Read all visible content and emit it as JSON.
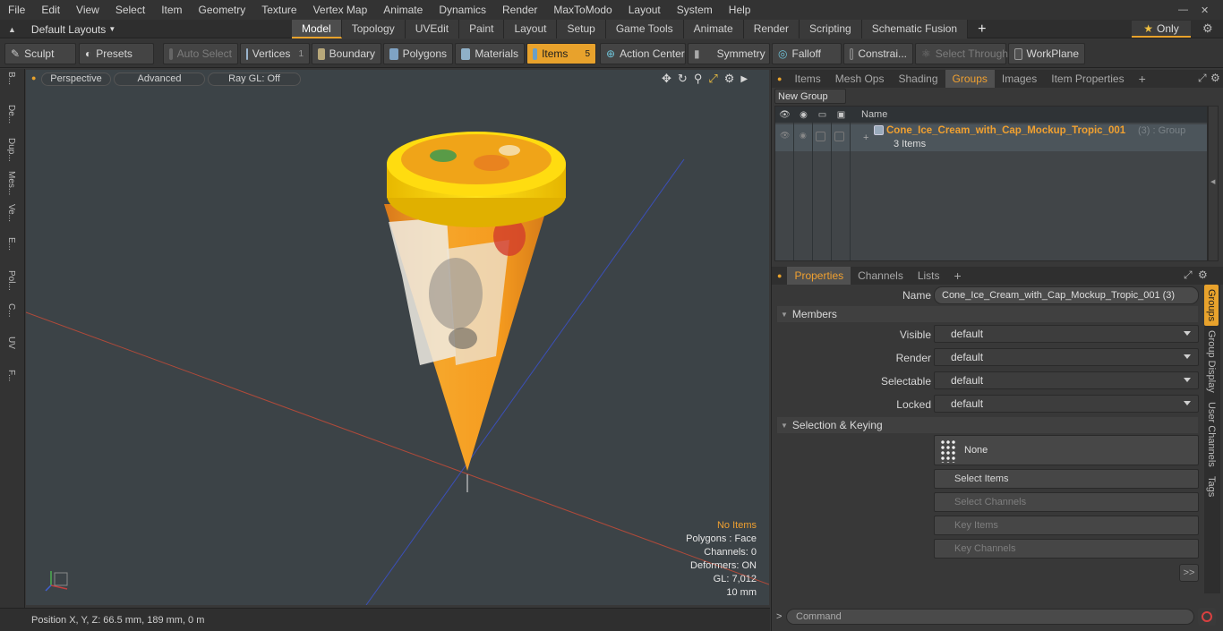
{
  "menubar": {
    "items": [
      "File",
      "Edit",
      "View",
      "Select",
      "Item",
      "Geometry",
      "Texture",
      "Vertex Map",
      "Animate",
      "Dynamics",
      "Render",
      "MaxToModo",
      "Layout",
      "System",
      "Help"
    ]
  },
  "layoutbar": {
    "layout_name": "Default Layouts",
    "tabs": [
      "Model",
      "Topology",
      "UVEdit",
      "Paint",
      "Layout",
      "Setup",
      "Game Tools",
      "Animate",
      "Render",
      "Scripting",
      "Schematic Fusion"
    ],
    "active_tab": "Model",
    "only_label": "Only"
  },
  "toolbar": {
    "sculpt": "Sculpt",
    "presets": "Presets",
    "auto_select": "Auto Select",
    "vertices": "Vertices",
    "vertices_count": "1",
    "boundary": "Boundary",
    "polygons": "Polygons",
    "materials": "Materials",
    "items": "Items",
    "items_count": "5",
    "action_center": "Action Center",
    "symmetry": "Symmetry",
    "falloff": "Falloff",
    "constraints": "Constrai...",
    "select_through": "Select Through",
    "workplane": "WorkPlane"
  },
  "leftstrip": {
    "tabs": [
      "B...",
      "De...",
      "Dup...",
      "Mes...",
      "Ve...",
      "E...",
      "Pol...",
      "C...",
      "UV",
      "F..."
    ]
  },
  "viewport": {
    "view_mode": "Perspective",
    "shading_mode": "Advanced",
    "raygl": "Ray GL: Off",
    "stats": {
      "no_items": "No Items",
      "polygons": "Polygons : Face",
      "channels": "Channels: 0",
      "deformers": "Deformers: ON",
      "gl": "GL: 7,012",
      "scale": "10 mm"
    }
  },
  "statusbar": {
    "position": "Position X, Y, Z:   66.5 mm, 189 mm, 0 m"
  },
  "groups_panel": {
    "tabs": [
      "Items",
      "Mesh Ops",
      "Shading",
      "Groups",
      "Images",
      "Item Properties"
    ],
    "active_tab": "Groups",
    "new_group": "New Group",
    "column_name": "Name",
    "group": {
      "name": "Cone_Ice_Cream_with_Cap_Mockup_Tropic_001",
      "suffix": "(3) : Group",
      "items_count": "3 Items"
    }
  },
  "properties_panel": {
    "tabs": [
      "Properties",
      "Channels",
      "Lists"
    ],
    "active_tab": "Properties",
    "name_label": "Name",
    "name_value": "Cone_Ice_Cream_with_Cap_Mockup_Tropic_001 (3)",
    "members_section": "Members",
    "visible_label": "Visible",
    "visible_value": "default",
    "render_label": "Render",
    "render_value": "default",
    "selectable_label": "Selectable",
    "selectable_value": "default",
    "locked_label": "Locked",
    "locked_value": "default",
    "selection_section": "Selection & Keying",
    "none_label": "None",
    "select_items": "Select Items",
    "select_channels": "Select Channels",
    "key_items": "Key Items",
    "key_channels": "Key Channels",
    "more": ">>",
    "side_tabs": [
      "Groups",
      "Group Display",
      "User Channels",
      "Tags"
    ]
  },
  "command": {
    "placeholder": "Command"
  },
  "colors": {
    "accent": "#e8a22c",
    "viewport_bg": "#3c4347",
    "cap_yellow": "#f7d800",
    "cone_orange": "#f39a1d"
  }
}
